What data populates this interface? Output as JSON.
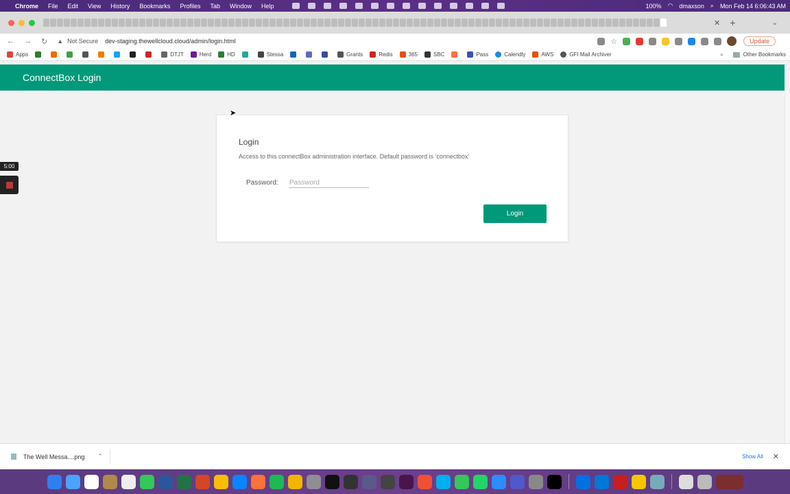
{
  "menubar": {
    "app_name": "Chrome",
    "menus": [
      "File",
      "Edit",
      "View",
      "History",
      "Bookmarks",
      "Profiles",
      "Tab",
      "Window",
      "Help"
    ],
    "battery": "100%",
    "username": "dmaxson",
    "datetime": "Mon Feb 14  6:06:43 AM"
  },
  "browser": {
    "security_label": "Not Secure",
    "url": "dev-staging.thewellcloud.cloud/admin/login.html",
    "update_label": "Update",
    "bookmarks": [
      "Apps",
      "DTJT",
      "Herd",
      "HD",
      "Stessa",
      "Grants",
      "Redis",
      "365",
      "SBC",
      "Pass",
      "Calendly",
      "AWS",
      "GFI Mail Archiver"
    ],
    "other_bookmarks": "Other Bookmarks"
  },
  "app": {
    "header_title": "ConnectBox Login"
  },
  "login": {
    "title": "Login",
    "description": "Access to this connectBox administration interface. Default password is 'connectbox'",
    "password_label": "Password:",
    "password_placeholder": "Password",
    "button_label": "Login"
  },
  "recorder": {
    "timer": "5:00"
  },
  "downloads": {
    "file_name": "The Well Messa....png",
    "show_all": "Show All"
  },
  "colors": {
    "brand_green": "#00997a",
    "menubar_purple": "#4a2a7a",
    "update_orange": "#d15b3a"
  }
}
